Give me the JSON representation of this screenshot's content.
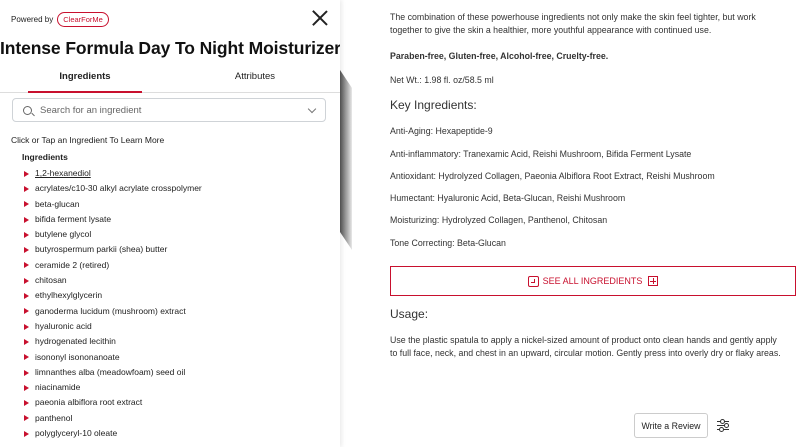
{
  "panel": {
    "powered_by": "Powered by",
    "brand": "ClearForMe",
    "title": "Intense Formula Day To Night Moisturizer",
    "tabs": [
      "Ingredients",
      "Attributes"
    ],
    "search_placeholder": "Search for an ingredient",
    "hint": "Click or Tap an Ingredient To Learn More",
    "list_header": "Ingredients",
    "ingredients": [
      "1,2-hexanediol",
      "acrylates/c10-30 alkyl acrylate crosspolymer",
      "beta-glucan",
      "bifida ferment lysate",
      "butylene glycol",
      "butyrospermum parkii (shea) butter",
      "ceramide 2 (retired)",
      "chitosan",
      "ethylhexylglycerin",
      "ganoderma lucidum (mushroom) extract",
      "hyaluronic acid",
      "hydrogenated lecithin",
      "isononyl isononanoate",
      "limnanthes alba (meadowfoam) seed oil",
      "niacinamide",
      "paeonia albiflora root extract",
      "panthenol",
      "polyglyceryl-10 oleate"
    ]
  },
  "product": {
    "intro": "The combination of these powerhouse ingredients not only make the skin feel tighter, but work together to give the skin a healthier, more youthful appearance with continued use.",
    "free_from": "Paraben-free, Gluten-free, Alcohol-free, Cruelty-free.",
    "net_wt": "Net Wt.: 1.98 fl. oz/58.5 ml",
    "key_heading": "Key Ingredients:",
    "key_items": [
      "Anti-Aging: Hexapeptide-9",
      "Anti-inflammatory: Tranexamic Acid, Reishi Mushroom, Bifida Ferment Lysate",
      "Antioxidant: Hydrolyzed Collagen, Paeonia Albiflora Root Extract, Reishi Mushroom",
      "Humectant: Hyaluronic Acid, Beta-Glucan, Reishi Mushroom",
      "Moisturizing: Hydrolyzed Collagen, Panthenol, Chitosan",
      "Tone Correcting: Beta-Glucan"
    ],
    "see_all": "SEE ALL INGREDIENTS",
    "usage_heading": "Usage:",
    "usage_text": "Use the plastic spatula to apply a nickel-sized amount of product onto clean hands and gently apply to full face, neck, and chest in an upward, circular motion.  Gently press into overly dry or flaky areas.",
    "write_review": "Write a Review"
  },
  "colors": {
    "accent": "#c8102e"
  }
}
